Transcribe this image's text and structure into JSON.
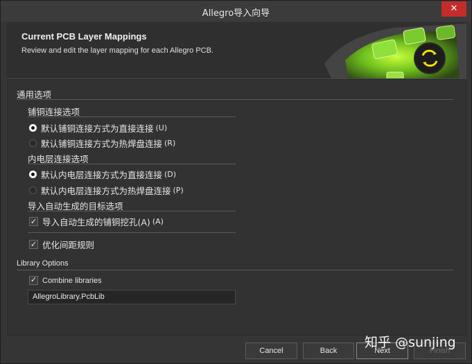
{
  "window": {
    "title": "Allegro导入向导",
    "close_label": "✕"
  },
  "header": {
    "title": "Current PCB Layer Mappings",
    "subtitle": "Review and edit the layer mapping for each Allegro PCB."
  },
  "general": {
    "label": "通用选项",
    "copper": {
      "label": "铺铜连接选项",
      "options": [
        {
          "label": "默认铺铜连接方式为直接连接",
          "shortcut": "(U)",
          "selected": true
        },
        {
          "label": "默认铺铜连接方式为热焊盘连接",
          "shortcut": "(R)",
          "selected": false
        }
      ]
    },
    "inner": {
      "label": "内电层连接选项",
      "options": [
        {
          "label": "默认内电层连接方式为直接连接",
          "shortcut": "(D)",
          "selected": true
        },
        {
          "label": "默认内电层连接方式为热焊盘连接",
          "shortcut": "(P)",
          "selected": false
        }
      ]
    },
    "autogen": {
      "label": "导入自动生成的目标选项",
      "cutout": {
        "label": "导入自动生成的铺铜挖孔(A)",
        "shortcut": "(A)",
        "checked": true
      },
      "rules": {
        "label": "优化间距规则",
        "checked": true
      }
    }
  },
  "library": {
    "label": "Library Options",
    "combine": {
      "label": "Combine libraries",
      "checked": true
    },
    "name_value": "AllegroLibrary.PcbLib"
  },
  "buttons": {
    "cancel": "Cancel",
    "back": "Back",
    "next": "Next",
    "finish": "Finish"
  },
  "watermark": "知乎 @sunjing"
}
